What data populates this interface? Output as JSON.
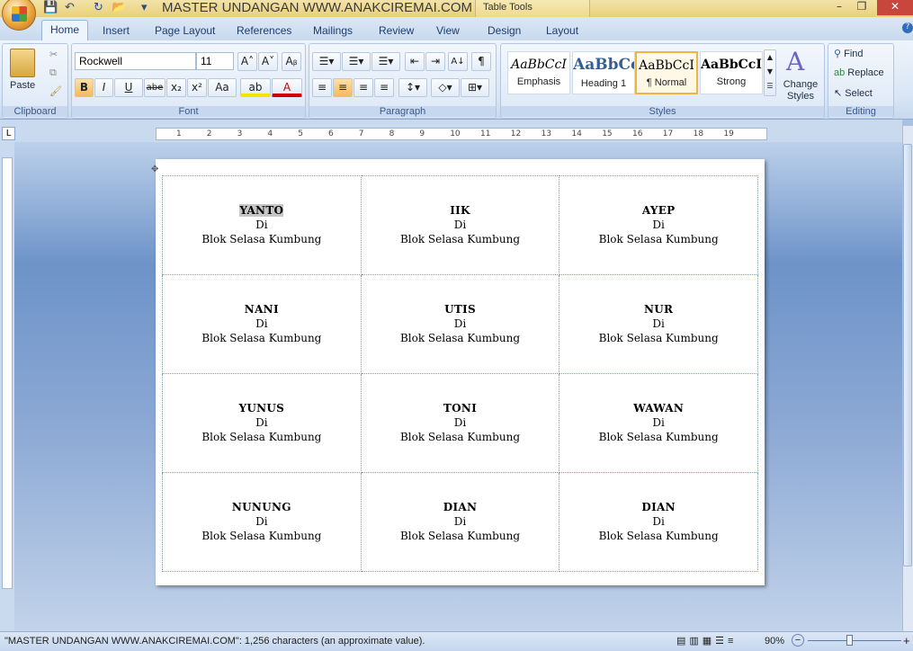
{
  "window": {
    "title": "MASTER UNDANGAN WWW.ANAKCIREMAI.COM ...",
    "context_tab": "Table Tools",
    "minimize": "–",
    "maximize": "❐",
    "close": "✕"
  },
  "qat": {
    "save": "💾",
    "undo": "↶",
    "redo": "↻",
    "open": "📂",
    "customize": "▾"
  },
  "tabs": [
    "Home",
    "Insert",
    "Page Layout",
    "References",
    "Mailings",
    "Review",
    "View",
    "Design",
    "Layout"
  ],
  "clipboard": {
    "paste": "Paste",
    "label": "Clipboard"
  },
  "font": {
    "name": "Rockwell",
    "size": "11",
    "label": "Font",
    "grow": "A˄",
    "shrink": "A˅",
    "bold": "B",
    "italic": "I",
    "underline": "U",
    "strike": "abe",
    "sub": "x₂",
    "sup": "x²",
    "case": "Aa",
    "highlight": "ab",
    "color": "A",
    "clear": "Aᵦ"
  },
  "paragraph": {
    "label": "Paragraph",
    "pilcrow": "¶",
    "sort": "A↓"
  },
  "styles": {
    "label": "Styles",
    "items": [
      {
        "sample": "AaBbCcI",
        "name": "Emphasis"
      },
      {
        "sample": "AaBbCc",
        "name": "Heading 1"
      },
      {
        "sample": "AaBbCcI",
        "name": "¶ Normal"
      },
      {
        "sample": "AaBbCcI",
        "name": "Strong"
      }
    ],
    "change": "Change Styles"
  },
  "editing": {
    "label": "Editing",
    "find": "Find",
    "replace": "Replace",
    "select": "Select"
  },
  "ruler": {
    "marks": [
      "1",
      "2",
      "3",
      "4",
      "5",
      "6",
      "7",
      "8",
      "9",
      "10",
      "11",
      "12",
      "13",
      "14",
      "15",
      "16",
      "17",
      "18",
      "19"
    ]
  },
  "table": {
    "rows": [
      [
        {
          "name": "YANTO",
          "line2": "Di",
          "line3": "Blok Selasa Kumbung"
        },
        {
          "name": "IIK",
          "line2": "Di",
          "line3": "Blok Selasa Kumbung"
        },
        {
          "name": "AYEP",
          "line2": "Di",
          "line3": "Blok Selasa Kumbung"
        }
      ],
      [
        {
          "name": "NANI",
          "line2": "Di",
          "line3": "Blok Selasa Kumbung"
        },
        {
          "name": "UTIS",
          "line2": "Di",
          "line3": "Blok Selasa Kumbung"
        },
        {
          "name": "NUR",
          "line2": "Di",
          "line3": "Blok Selasa Kumbung"
        }
      ],
      [
        {
          "name": "YUNUS",
          "line2": "Di",
          "line3": "Blok Selasa Kumbung"
        },
        {
          "name": "TONI",
          "line2": "Di",
          "line3": "Blok Selasa Kumbung"
        },
        {
          "name": "WAWAN",
          "line2": "Di",
          "line3": "Blok Selasa Kumbung"
        }
      ],
      [
        {
          "name": "NUNUNG",
          "line2": "Di",
          "line3": "Blok Selasa Kumbung"
        },
        {
          "name": "DIAN",
          "line2": "Di",
          "line3": "Blok Selasa Kumbung"
        },
        {
          "name": "DIAN",
          "line2": "Di",
          "line3": "Blok Selasa Kumbung"
        }
      ]
    ]
  },
  "status": {
    "text": "\"MASTER UNDANGAN WWW.ANAKCIREMAI.COM\": 1,256 characters (an approximate value).",
    "zoom": "90%",
    "zoom_percent": 90
  }
}
